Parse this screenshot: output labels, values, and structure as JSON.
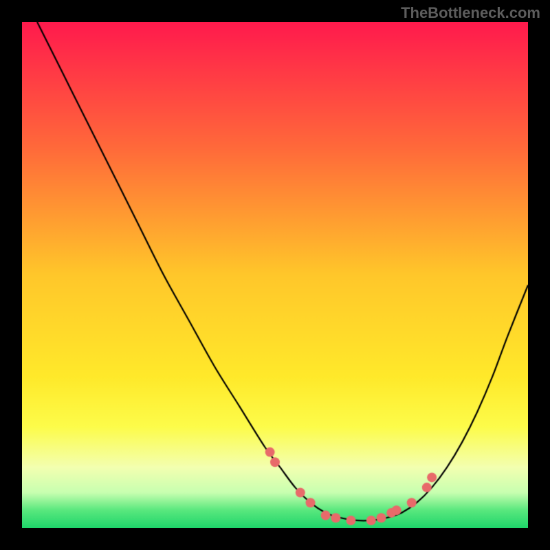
{
  "watermark": "TheBottleneck.com",
  "chart_data": {
    "type": "line",
    "title": "",
    "xlabel": "",
    "ylabel": "",
    "xlim": [
      0,
      100
    ],
    "ylim": [
      0,
      100
    ],
    "curve": {
      "x": [
        3,
        8,
        13,
        18,
        23,
        28,
        33,
        38,
        43,
        48,
        51,
        54,
        57,
        60,
        63,
        66,
        69,
        72,
        75,
        78,
        81,
        84,
        87,
        90,
        93,
        96,
        100
      ],
      "y": [
        100,
        90,
        80,
        70,
        60,
        50,
        41,
        32,
        24,
        16,
        12,
        8,
        5,
        3,
        2,
        1.5,
        1.5,
        2,
        3,
        5,
        8,
        12,
        17,
        23,
        30,
        38,
        48
      ]
    },
    "dots": {
      "x": [
        49,
        50,
        55,
        57,
        60,
        62,
        65,
        69,
        71,
        73,
        74,
        77,
        80,
        81
      ],
      "y": [
        15,
        13,
        7,
        5,
        2.5,
        2,
        1.5,
        1.5,
        2,
        3,
        3.5,
        5,
        8,
        10
      ]
    },
    "gradient_stops": [
      {
        "offset": 0.0,
        "color": "#ff1a4d"
      },
      {
        "offset": 0.25,
        "color": "#ff6a3a"
      },
      {
        "offset": 0.5,
        "color": "#ffc72a"
      },
      {
        "offset": 0.7,
        "color": "#ffe92a"
      },
      {
        "offset": 0.8,
        "color": "#fdfc4a"
      },
      {
        "offset": 0.88,
        "color": "#f3ffb0"
      },
      {
        "offset": 0.93,
        "color": "#c8ffb0"
      },
      {
        "offset": 0.965,
        "color": "#59e87e"
      },
      {
        "offset": 1.0,
        "color": "#1fd56a"
      }
    ],
    "dot_color": "#e86a6a",
    "line_color": "#000000"
  }
}
